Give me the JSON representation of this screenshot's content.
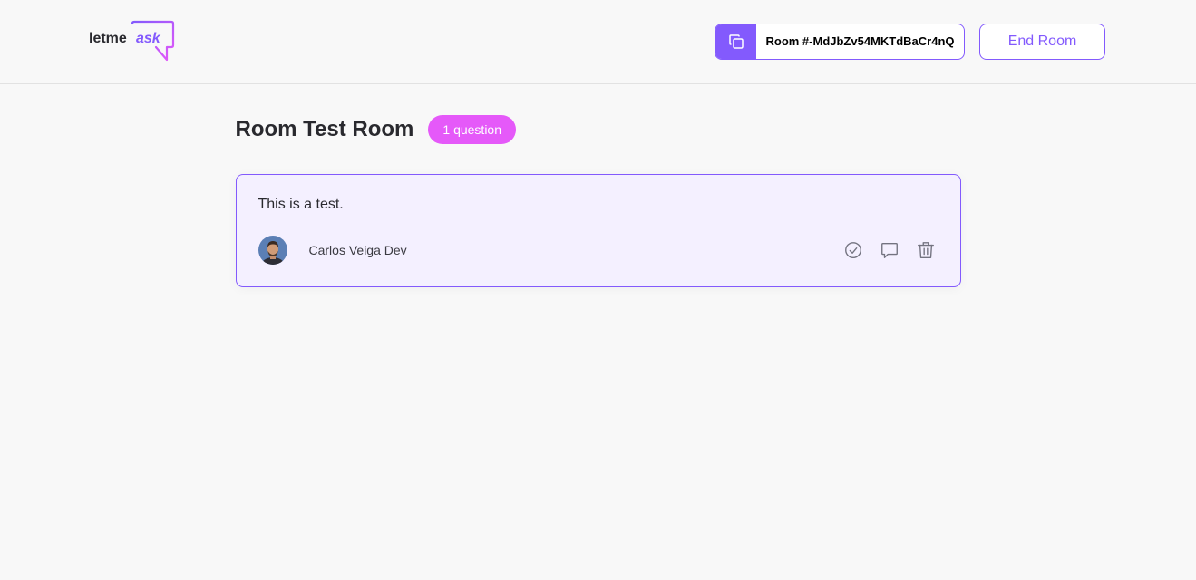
{
  "header": {
    "logo": {
      "text_main": "letme",
      "text_accent": "ask",
      "icon": "speech-bubble-logo"
    },
    "room_code": {
      "icon": "copy-icon",
      "label": "Room #-MdJbZv54MKTdBaCr4nQ"
    },
    "end_room_label": "End Room"
  },
  "room": {
    "title": "Room Test Room",
    "question_count": "1 question"
  },
  "questions": [
    {
      "content": "This is a test.",
      "author": {
        "name": "Carlos Veiga Dev",
        "avatar": "avatar"
      },
      "actions": [
        {
          "name": "check-icon",
          "label": "Mark as answered"
        },
        {
          "name": "comment-icon",
          "label": "Highlight question"
        },
        {
          "name": "trash-icon",
          "label": "Delete question"
        }
      ]
    }
  ],
  "colors": {
    "accent": "#835afd",
    "badge": "#e559f9",
    "question_bg": "#f4f0ff",
    "page_bg": "#f8f8f8"
  }
}
